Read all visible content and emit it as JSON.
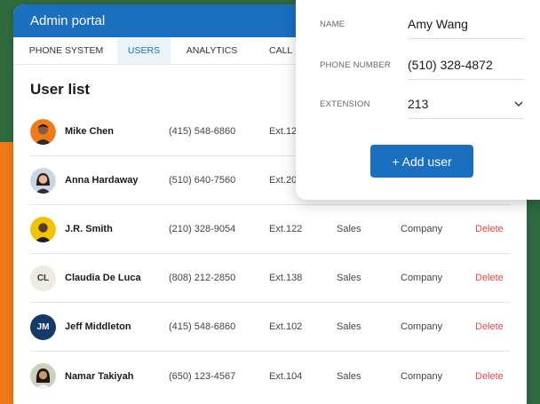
{
  "colors": {
    "accent": "#1a6fc0",
    "delete": "#e0474c"
  },
  "header": {
    "title": "Admin portal"
  },
  "tabs": [
    {
      "label": "PHONE SYSTEM"
    },
    {
      "label": "USERS"
    },
    {
      "label": "ANALYTICS"
    },
    {
      "label": "CALL"
    }
  ],
  "list": {
    "title": "User list",
    "delete_label": "Delete",
    "users": [
      {
        "name": "Mike Chen",
        "phone": "(415) 548-6860",
        "ext": "Ext.12",
        "dept": "",
        "scope": "",
        "avatar": "photo"
      },
      {
        "name": "Anna Hardaway",
        "phone": "(510) 640-7560",
        "ext": "Ext.20",
        "dept": "",
        "scope": "",
        "avatar": "photo"
      },
      {
        "name": "J.R. Smith",
        "phone": "(210) 328-9054",
        "ext": "Ext.122",
        "dept": "Sales",
        "scope": "Company",
        "avatar": "photo"
      },
      {
        "name": "Claudia De Luca",
        "phone": "(808) 212-2850",
        "ext": "Ext.138",
        "dept": "Sales",
        "scope": "Company",
        "initials": "CL"
      },
      {
        "name": "Jeff Middleton",
        "phone": "(415) 548-6860",
        "ext": "Ext.102",
        "dept": "Sales",
        "scope": "Company",
        "initials": "JM"
      },
      {
        "name": "Namar Takiyah",
        "phone": "(650) 123-4567",
        "ext": "Ext.104",
        "dept": "Sales",
        "scope": "Company",
        "avatar": "photo"
      }
    ]
  },
  "form": {
    "name_label": "NAME",
    "name_value": "Amy Wang",
    "phone_label": "PHONE NUMBER",
    "phone_value": "(510) 328-4872",
    "ext_label": "EXTENSION",
    "ext_value": "213",
    "add_button": "+ Add user"
  }
}
